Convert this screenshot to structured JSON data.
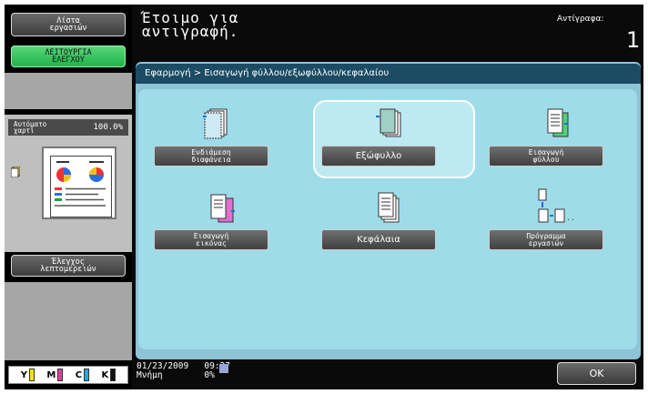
{
  "sidebar": {
    "job_list": "Λίστα\nεργασιών",
    "check_mode": "ΛΕΙΤΟΥΡΓΙΑ\nΕΛΕΓΧΟΥ",
    "auto_paper_label": "Αυτόματο\nχαρτί",
    "zoom": "100.0%",
    "details": "Έλεγχος\nλεπτομερειών"
  },
  "header": {
    "title": "Έτοιμο για\nαντιγραφή.",
    "copies_label": "Αντίγραφα:",
    "copies_value": "1"
  },
  "breadcrumb": "Εφαρμογή > Εισαγωγή φύλλου/εξωφύλλου/κεφαλαίου",
  "functions": [
    {
      "label": "Ενδιάμεση\nδιαφάνεια",
      "icon": "transparency-interleave-icon"
    },
    {
      "label": "Εξώφυλλο",
      "icon": "cover-sheet-icon",
      "selected": true
    },
    {
      "label": "Εισαγωγή\nφύλλου",
      "icon": "insert-sheet-icon"
    },
    {
      "label": "Εισαγωγή\nεικόνας",
      "icon": "insert-image-icon"
    },
    {
      "label": "Κεφάλαια",
      "icon": "chapters-icon"
    },
    {
      "label": "Πρόγραμμα\nεργασιών",
      "icon": "job-program-icon"
    }
  ],
  "status": {
    "date": "01/23/2009",
    "time": "09:27",
    "memory_label": "Μνήμη",
    "memory_value": "0%"
  },
  "ok_label": "OK",
  "cmyk": [
    "Y",
    "M",
    "C",
    "K"
  ],
  "colors": {
    "accent": "#9fdce9",
    "panel": "#1c4b64",
    "green": "#21b14b",
    "toner_y": "#f0e020",
    "toner_m": "#e040a0",
    "toner_c": "#20a8e0",
    "toner_k": "#111111"
  }
}
